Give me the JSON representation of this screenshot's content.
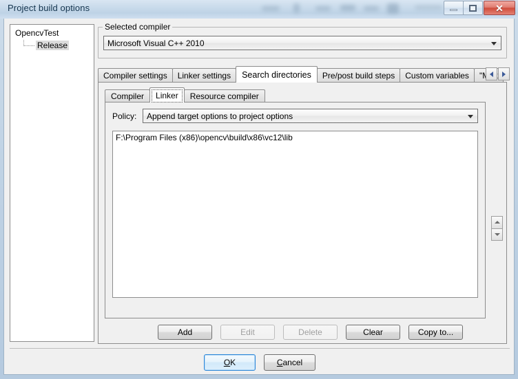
{
  "window": {
    "title": "Project build options",
    "controls": {
      "minimize": "minimize-button",
      "restore": "restore-button",
      "close_glyph": "✕"
    }
  },
  "tree": {
    "root_label": "OpencvTest",
    "child_label": "Release",
    "selected": "Release"
  },
  "compiler_group": {
    "legend": "Selected compiler",
    "selected_value": "Microsoft Visual C++ 2010"
  },
  "outer_tabs": {
    "items": [
      {
        "label": "Compiler settings",
        "active": false
      },
      {
        "label": "Linker settings",
        "active": false
      },
      {
        "label": "Search directories",
        "active": true
      },
      {
        "label": "Pre/post build steps",
        "active": false
      },
      {
        "label": "Custom variables",
        "active": false
      },
      {
        "label": "\"Make",
        "active": false
      }
    ],
    "scroll_left": "◄",
    "scroll_right": "►"
  },
  "inner_tabs": {
    "items": [
      {
        "label": "Compiler",
        "active": false
      },
      {
        "label": "Linker",
        "active": true
      },
      {
        "label": "Resource compiler",
        "active": false
      }
    ]
  },
  "policy": {
    "label": "Policy:",
    "selected_value": "Append target options to project options"
  },
  "directories": {
    "items": [
      "F:\\Program Files (x86)\\opencv\\build\\x86\\vc12\\lib"
    ]
  },
  "action_buttons": [
    {
      "label": "Add",
      "enabled": true
    },
    {
      "label": "Edit",
      "enabled": false
    },
    {
      "label": "Delete",
      "enabled": false
    },
    {
      "label": "Clear",
      "enabled": true
    },
    {
      "label": "Copy to...",
      "enabled": true
    }
  ],
  "footer": {
    "ok": {
      "prefix": "",
      "accel": "O",
      "suffix": "K"
    },
    "cancel": {
      "prefix": "",
      "accel": "C",
      "suffix": "ancel"
    }
  },
  "colors": {
    "dialog_bg": "#f0f0f0",
    "field_bg": "#ffffff",
    "border": "#8c8c8c",
    "title_text": "#14344e",
    "default_button_accent": "#2c86d8",
    "close_button": "#cf4d3c",
    "selection": "#dcdcdc"
  }
}
